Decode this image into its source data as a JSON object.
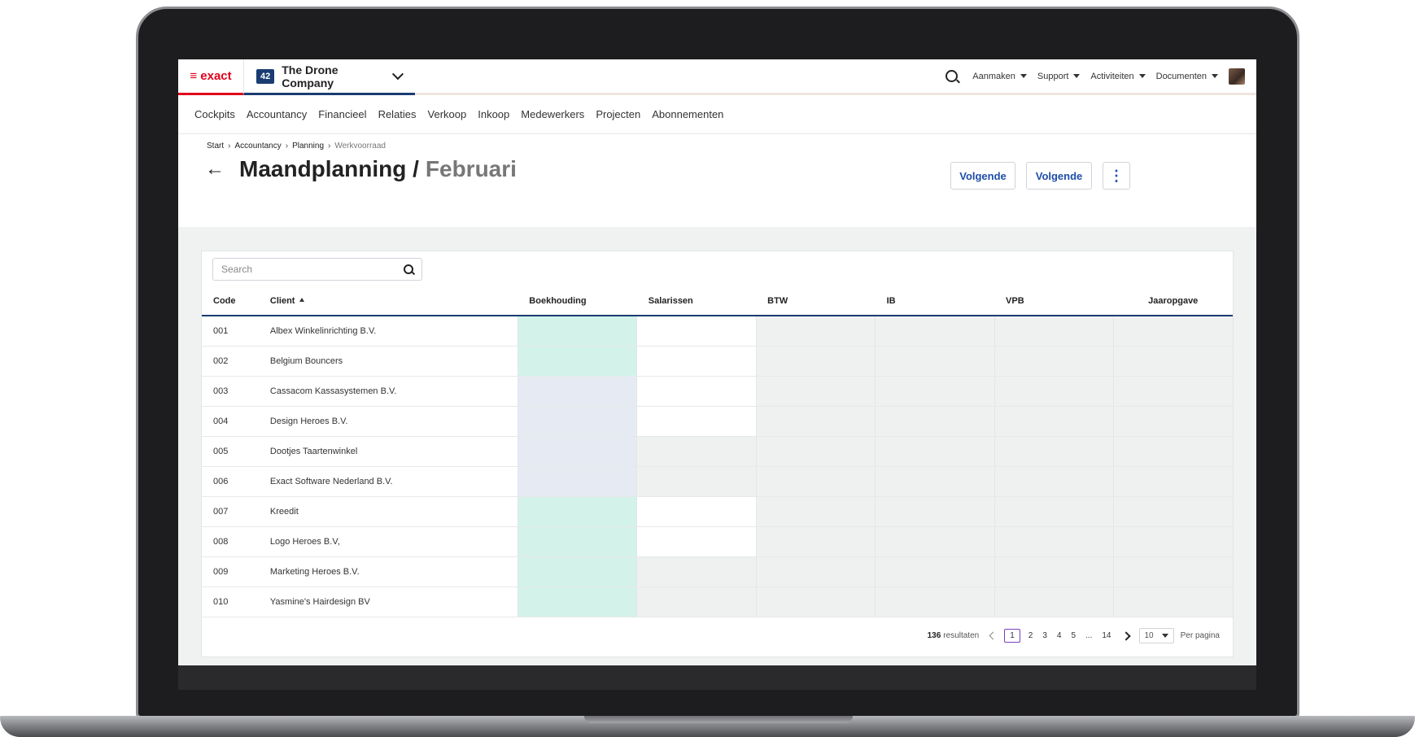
{
  "topbar": {
    "logo": "≡ exact",
    "company_badge": "42",
    "company_name": "The Drone Company",
    "menus": [
      "Aanmaken",
      "Support",
      "Activiteiten",
      "Documenten"
    ]
  },
  "nav": [
    "Cockpits",
    "Accountancy",
    "Financieel",
    "Relaties",
    "Verkoop",
    "Inkoop",
    "Medewerkers",
    "Projecten",
    "Abonnementen"
  ],
  "breadcrumb": [
    "Start",
    "Accountancy",
    "Planning",
    "Werkvoorraad"
  ],
  "title": {
    "main": "Maandplanning /",
    "sub": "Februari"
  },
  "buttons": {
    "first": "Volgende",
    "second": "Volgende",
    "more": "⋮"
  },
  "search": {
    "placeholder": "Search"
  },
  "table": {
    "headers": [
      "Code",
      "Client",
      "Boekhouding",
      "Salarissen",
      "BTW",
      "IB",
      "VPB",
      "Jaaropgave"
    ],
    "rows": [
      {
        "code": "001",
        "client": "Albex Winkelinrichting B.V.",
        "cells": [
          "green",
          "white",
          "grey",
          "grey",
          "grey",
          "grey"
        ]
      },
      {
        "code": "002",
        "client": "Belgium Bouncers",
        "cells": [
          "green",
          "white",
          "grey",
          "grey",
          "grey",
          "grey"
        ]
      },
      {
        "code": "003",
        "client": "Cassacom Kassasystemen B.V.",
        "cells": [
          "blue",
          "white",
          "grey",
          "grey",
          "grey",
          "grey"
        ]
      },
      {
        "code": "004",
        "client": "Design Heroes B.V.",
        "cells": [
          "blue",
          "white",
          "grey",
          "grey",
          "grey",
          "grey"
        ]
      },
      {
        "code": "005",
        "client": "Dootjes Taartenwinkel",
        "cells": [
          "blue",
          "grey",
          "grey",
          "grey",
          "grey",
          "grey"
        ]
      },
      {
        "code": "006",
        "client": "Exact Software Nederland B.V.",
        "cells": [
          "blue",
          "grey",
          "grey",
          "grey",
          "grey",
          "grey"
        ]
      },
      {
        "code": "007",
        "client": "Kreedit",
        "cells": [
          "green",
          "white",
          "grey",
          "grey",
          "grey",
          "grey"
        ]
      },
      {
        "code": "008",
        "client": "Logo Heroes B.V,",
        "cells": [
          "green",
          "white",
          "grey",
          "grey",
          "grey",
          "grey"
        ]
      },
      {
        "code": "009",
        "client": "Marketing Heroes B.V.",
        "cells": [
          "green",
          "grey",
          "grey",
          "grey",
          "grey",
          "grey"
        ]
      },
      {
        "code": "010",
        "client": "Yasmine's Hairdesign BV",
        "cells": [
          "green",
          "grey",
          "grey",
          "grey",
          "grey",
          "grey"
        ]
      }
    ]
  },
  "pagination": {
    "count": "136",
    "results_label": "resultaten",
    "pages": [
      "1",
      "2",
      "3",
      "4",
      "5",
      "...",
      "14"
    ],
    "active_page": "1",
    "per_page_value": "10",
    "per_page_label": "Per pagina"
  },
  "colors": {
    "brand": "#e1001a",
    "primary": "#1a3c72",
    "link": "#1f4ea8",
    "green": "#d3f2ea",
    "blue": "#e6ebf3",
    "grey": "#eff1f1"
  }
}
